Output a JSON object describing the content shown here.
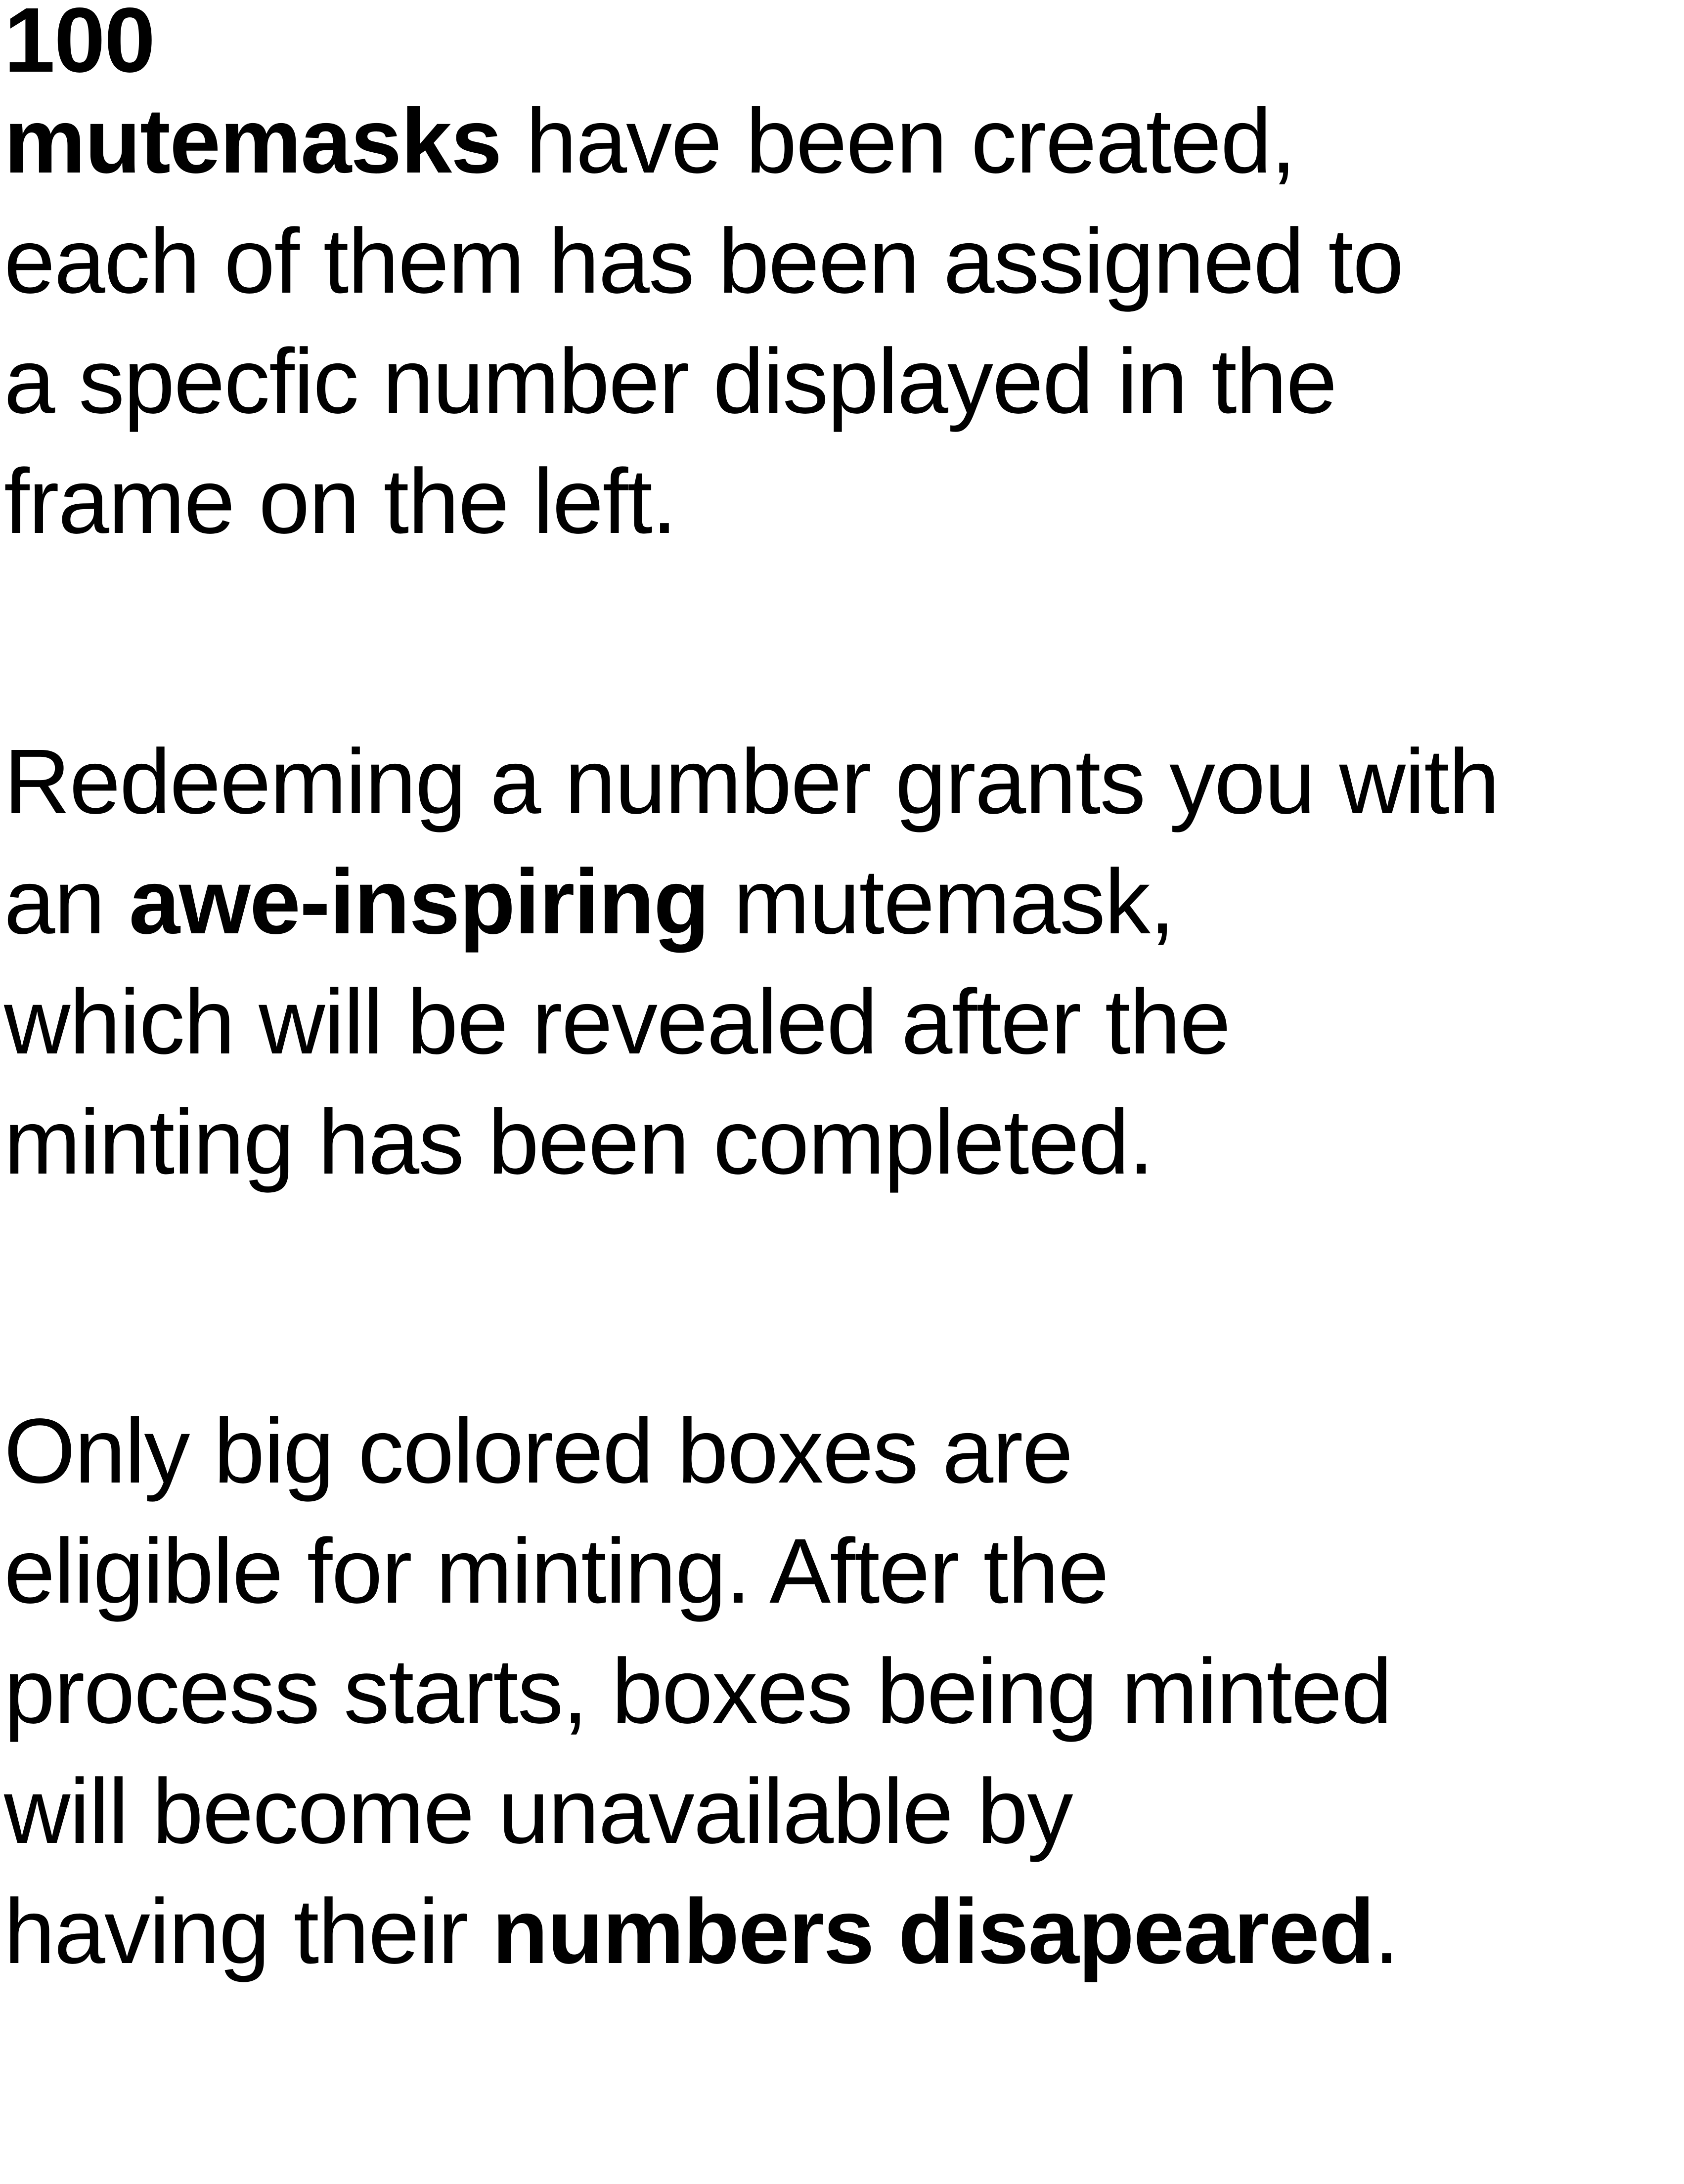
{
  "intro": {
    "count": "100",
    "subject": "mutemasks",
    "line1_rest": " have been created,",
    "line2": "each of them has been assigned to",
    "line3": "a specfic number displayed in the",
    "line4": "frame on the left."
  },
  "redeem": {
    "line1": "Redeeming a number grants you with",
    "line2_pre": "an ",
    "line2_bold": "awe-inspiring",
    "line2_post": " mutemask,",
    "line3": "which will be revealed after the",
    "line4": "minting has been completed."
  },
  "eligibility": {
    "line1": "Only big colored boxes are",
    "line2": "eligible for minting. After the",
    "line3": "process starts, boxes being minted",
    "line4": "will become unavailable by",
    "line5_pre": "having their ",
    "line5_bold": "numbers disapeared",
    "line5_post": "."
  }
}
